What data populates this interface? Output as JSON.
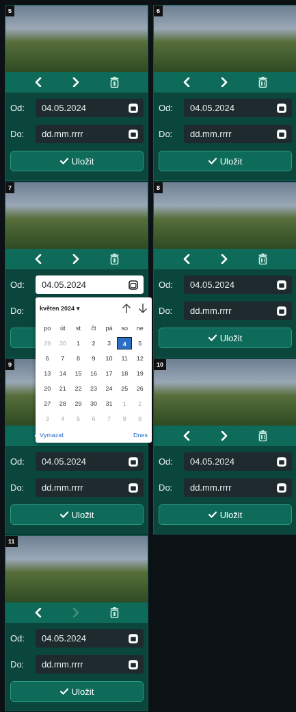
{
  "cards": [
    {
      "number": "5",
      "from": {
        "label": "Od:",
        "value": "04.05.2024",
        "focused": false
      },
      "to": {
        "label": "Do:",
        "placeholder": "dd.mm.rrrr"
      },
      "save": {
        "label": "Uložit"
      },
      "next_disabled": false
    },
    {
      "number": "6",
      "from": {
        "label": "Od:",
        "value": "04.05.2024",
        "focused": false
      },
      "to": {
        "label": "Do:",
        "placeholder": "dd.mm.rrrr"
      },
      "save": {
        "label": "Uložit"
      },
      "next_disabled": false
    },
    {
      "number": "7",
      "from": {
        "label": "Od:",
        "value": "04.05.2024",
        "focused": true
      },
      "to": {
        "label": "Do:"
      },
      "next_disabled": false
    },
    {
      "number": "8",
      "from": {
        "label": "Od:",
        "value": "04.05.2024",
        "focused": false
      },
      "to": {
        "label": "Do:",
        "placeholder": "dd.mm.rrrr"
      },
      "save": {
        "label": "Uložit"
      },
      "next_disabled": false
    },
    {
      "number": "9",
      "controls_hidden": true,
      "from": {
        "label": "Od:",
        "value": "04.05.2024",
        "focused": false
      },
      "to": {
        "label": "Do:",
        "placeholder": "dd.mm.rrrr"
      },
      "save": {
        "label": "Uložit"
      }
    },
    {
      "number": "10",
      "from": {
        "label": "Od:",
        "value": "04.05.2024",
        "focused": false
      },
      "to": {
        "label": "Do:",
        "placeholder": "dd.mm.rrrr"
      },
      "save": {
        "label": "Uložit"
      },
      "next_disabled": false
    },
    {
      "number": "11",
      "from": {
        "label": "Od:",
        "value": "04.05.2024",
        "focused": false
      },
      "to": {
        "label": "Do:",
        "placeholder": "dd.mm.rrrr"
      },
      "save": {
        "label": "Uložit"
      },
      "next_disabled": true
    }
  ],
  "date_picker": {
    "month": "květen 2024 ▾",
    "weekdays": [
      "po",
      "út",
      "st",
      "čt",
      "pá",
      "so",
      "ne"
    ],
    "weeks": [
      [
        {
          "day": "29",
          "muted": true,
          "selected": false
        },
        {
          "day": "30",
          "muted": true,
          "selected": false
        },
        {
          "day": "1",
          "muted": false,
          "selected": false
        },
        {
          "day": "2",
          "muted": false,
          "selected": false
        },
        {
          "day": "3",
          "muted": false,
          "selected": false
        },
        {
          "day": "4",
          "muted": false,
          "selected": true
        },
        {
          "day": "5",
          "muted": false,
          "selected": false
        }
      ],
      [
        {
          "day": "6",
          "muted": false,
          "selected": false
        },
        {
          "day": "7",
          "muted": false,
          "selected": false
        },
        {
          "day": "8",
          "muted": false,
          "selected": false
        },
        {
          "day": "9",
          "muted": false,
          "selected": false
        },
        {
          "day": "10",
          "muted": false,
          "selected": false
        },
        {
          "day": "11",
          "muted": false,
          "selected": false
        },
        {
          "day": "12",
          "muted": false,
          "selected": false
        }
      ],
      [
        {
          "day": "13",
          "muted": false,
          "selected": false
        },
        {
          "day": "14",
          "muted": false,
          "selected": false
        },
        {
          "day": "15",
          "muted": false,
          "selected": false
        },
        {
          "day": "16",
          "muted": false,
          "selected": false
        },
        {
          "day": "17",
          "muted": false,
          "selected": false
        },
        {
          "day": "18",
          "muted": false,
          "selected": false
        },
        {
          "day": "19",
          "muted": false,
          "selected": false
        }
      ],
      [
        {
          "day": "20",
          "muted": false,
          "selected": false
        },
        {
          "day": "21",
          "muted": false,
          "selected": false
        },
        {
          "day": "22",
          "muted": false,
          "selected": false
        },
        {
          "day": "23",
          "muted": false,
          "selected": false
        },
        {
          "day": "24",
          "muted": false,
          "selected": false
        },
        {
          "day": "25",
          "muted": false,
          "selected": false
        },
        {
          "day": "26",
          "muted": false,
          "selected": false
        }
      ],
      [
        {
          "day": "27",
          "muted": false,
          "selected": false
        },
        {
          "day": "28",
          "muted": false,
          "selected": false
        },
        {
          "day": "29",
          "muted": false,
          "selected": false
        },
        {
          "day": "30",
          "muted": false,
          "selected": false
        },
        {
          "day": "31",
          "muted": false,
          "selected": false
        },
        {
          "day": "1",
          "muted": true,
          "selected": false
        },
        {
          "day": "2",
          "muted": true,
          "selected": false
        }
      ],
      [
        {
          "day": "3",
          "muted": true,
          "selected": false
        },
        {
          "day": "4",
          "muted": true,
          "selected": false
        },
        {
          "day": "5",
          "muted": true,
          "selected": false
        },
        {
          "day": "6",
          "muted": true,
          "selected": false
        },
        {
          "day": "7",
          "muted": true,
          "selected": false
        },
        {
          "day": "8",
          "muted": true,
          "selected": false
        },
        {
          "day": "9",
          "muted": true,
          "selected": false
        }
      ]
    ],
    "clear": "Vymazat",
    "today": "Dnes"
  }
}
